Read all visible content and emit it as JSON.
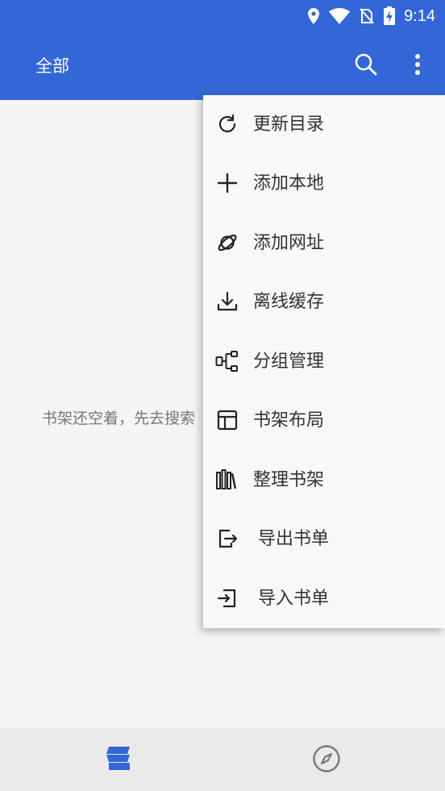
{
  "status_bar": {
    "time": "9:14",
    "icons": [
      "location-icon",
      "wifi-icon",
      "no-sim-icon",
      "battery-charging-icon"
    ]
  },
  "app_bar": {
    "title": "全部",
    "actions": [
      "search-icon",
      "more-vert-icon"
    ]
  },
  "content": {
    "empty_message": "书架还空着，先去搜索"
  },
  "menu": {
    "items": [
      {
        "label": "更新目录",
        "icon": "refresh-icon"
      },
      {
        "label": "添加本地",
        "icon": "plus-icon"
      },
      {
        "label": "添加网址",
        "icon": "planet-icon"
      },
      {
        "label": "离线缓存",
        "icon": "download-icon"
      },
      {
        "label": "分组管理",
        "icon": "group-icon"
      },
      {
        "label": "书架布局",
        "icon": "layout-icon"
      },
      {
        "label": "整理书架",
        "icon": "books-icon"
      },
      {
        "label": "导出书单",
        "icon": "export-icon"
      },
      {
        "label": "导入书单",
        "icon": "import-icon"
      }
    ]
  },
  "bottom_nav": {
    "items": [
      {
        "icon": "bookshelf-icon",
        "active": true
      },
      {
        "icon": "compass-icon",
        "active": false
      }
    ]
  },
  "colors": {
    "primary": "#3366d6",
    "background": "#f5f5f5",
    "menu_bg": "#f8f8f8",
    "bottom_nav_bg": "#eaeaea",
    "inactive_icon": "#777777"
  }
}
